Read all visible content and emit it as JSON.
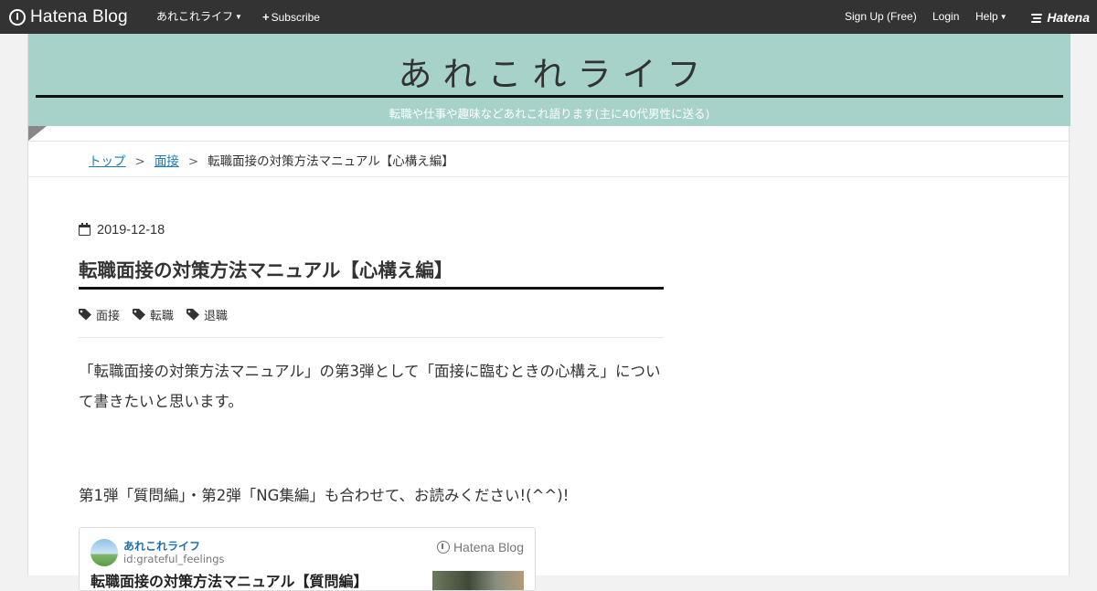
{
  "navbar": {
    "logo_text": "Hatena Blog",
    "blog_menu_label": "あれこれライフ",
    "subscribe_label": "Subscribe",
    "signup_label": "Sign Up (Free)",
    "login_label": "Login",
    "help_label": "Help",
    "brand_text": "Hatena"
  },
  "header": {
    "title": "あれこれライフ",
    "description": "転職や仕事や趣味などあれこれ語ります(主に40代男性に送る)"
  },
  "breadcrumb": {
    "items": [
      "トップ",
      "面接"
    ],
    "separator": ">",
    "current": "転職面接の対策方法マニュアル【心構え編】"
  },
  "article": {
    "date": "2019-12-18",
    "title": "転職面接の対策方法マニュアル【心構え編】",
    "tags": [
      "面接",
      "転職",
      "退職"
    ],
    "paragraphs": [
      "「転職面接の対策方法マニュアル」の第3弾として「面接に臨むときの心構え」について書きたいと思います。",
      "第1弾「質問編」・第2弾「NG集編」も合わせて、お読みください!(^^)!"
    ]
  },
  "embed_card": {
    "blog_name": "あれこれライフ",
    "user_id": "id:grateful_feelings",
    "brand_text": "Hatena Blog",
    "title": "転職面接の対策方法マニュアル【質問編】"
  },
  "colors": {
    "navbar_bg": "#333333",
    "header_bg": "#a6d2c9",
    "link": "#1e7ab0"
  }
}
